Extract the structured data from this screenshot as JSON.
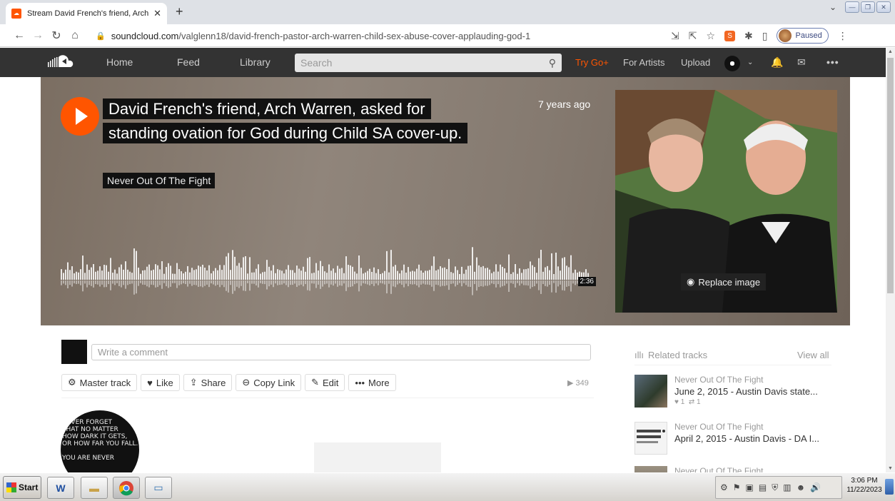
{
  "browser": {
    "tab_title": "Stream David French's friend, Arch",
    "tab_favicon": "soundcloud-favicon",
    "url_host": "soundcloud.com",
    "url_path": "/valglenn18/david-french-pastor-arch-warren-child-sex-abuse-cover-applauding-god-1",
    "profile_status": "Paused"
  },
  "header": {
    "nav": [
      "Home",
      "Feed",
      "Library"
    ],
    "search_placeholder": "Search",
    "try_go": "Try Go+",
    "for_artists": "For Artists",
    "upload": "Upload"
  },
  "track": {
    "title": "David French's friend, Arch Warren, asked for standing ovation for God during Child SA cover-up.",
    "artist": "Never Out Of The Fight",
    "posted": "7 years ago",
    "duration": "2:36",
    "replace_image": "Replace image",
    "comment_placeholder": "Write a comment",
    "plays": "349",
    "actions": [
      "Master track",
      "Like",
      "Share",
      "Copy Link",
      "Edit",
      "More"
    ]
  },
  "profile_art_text": "NEVER FORGET\nTHAT NO MATTER\nHOW DARK IT GETS,\nOR HOW FAR YOU FALL.\n\nYOU ARE NEVER",
  "sidebar": {
    "related_title": "Related tracks",
    "view_all": "View all",
    "items": [
      {
        "artist": "Never Out Of The Fight",
        "title": "June 2, 2015 - Austin Davis state...",
        "likes": "1",
        "reposts": "1"
      },
      {
        "artist": "Never Out Of The Fight",
        "title": "April 2, 2015 - Austin Davis - DA I..."
      },
      {
        "artist": "Never Out Of The Fight"
      }
    ]
  },
  "taskbar": {
    "start": "Start",
    "time": "3:06 PM",
    "date": "11/22/2023"
  },
  "colors": {
    "accent": "#ff5500",
    "header_bg": "#333333"
  }
}
